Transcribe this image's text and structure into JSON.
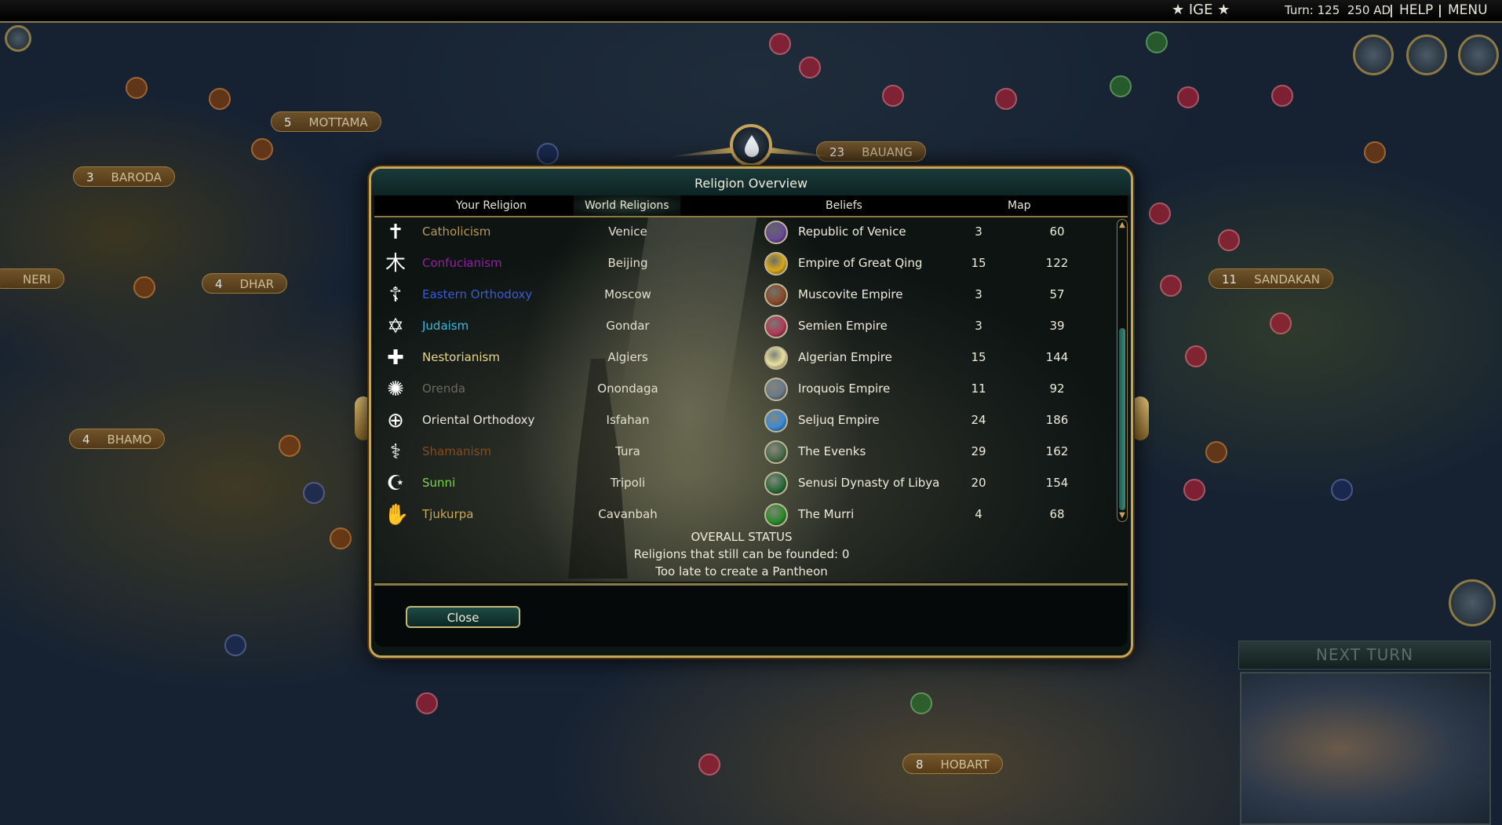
{
  "topbar": {
    "ige_label": "★ IGE ★",
    "turn_label": "Turn: 125",
    "date_label": "250 AD",
    "help_label": "HELP",
    "menu_label": "MENU"
  },
  "map": {
    "cities": [
      {
        "pop": "5",
        "name": "MOTTAMA"
      },
      {
        "pop": "3",
        "name": "BARODA"
      },
      {
        "pop": "4",
        "name": "DHAR"
      },
      {
        "pop": "4",
        "name": "BHAMO"
      },
      {
        "pop": "23",
        "name": "BAUANG"
      },
      {
        "pop": "11",
        "name": "SANDAKAN"
      },
      {
        "pop": "8",
        "name": "HOBART"
      },
      {
        "pop": "",
        "name": "NERI"
      }
    ],
    "next_turn_label": "NEXT TURN"
  },
  "dialog": {
    "title": "Religion Overview",
    "tabs": [
      "Your Religion",
      "World Religions",
      "Beliefs",
      "Map"
    ],
    "active_tab": "World Religions",
    "religions": [
      {
        "icon": "✝",
        "name": "Catholicism",
        "color": "#b8985a",
        "city": "Venice",
        "civ": "Republic of Venice",
        "civ_color": "#6a4a9a",
        "followers": "3",
        "cities": "60"
      },
      {
        "icon": "木",
        "name": "Confucianism",
        "color": "#9a1aa8",
        "city": "Beijing",
        "civ": "Empire of Great Qing",
        "civ_color": "#d8a818",
        "followers": "15",
        "cities": "122"
      },
      {
        "icon": "☦",
        "name": "Eastern Orthodoxy",
        "color": "#3a5ad8",
        "city": "Moscow",
        "civ": "Muscovite Empire",
        "civ_color": "#8a4a2a",
        "followers": "3",
        "cities": "57"
      },
      {
        "icon": "✡",
        "name": "Judaism",
        "color": "#3ab8e0",
        "city": "Gondar",
        "civ": "Semien Empire",
        "civ_color": "#b03a5a",
        "followers": "3",
        "cities": "39"
      },
      {
        "icon": "✚",
        "name": "Nestorianism",
        "color": "#e8d88a",
        "city": "Algiers",
        "civ": "Algerian Empire",
        "civ_color": "#e8e0a0",
        "followers": "15",
        "cities": "144"
      },
      {
        "icon": "✺",
        "name": "Orenda",
        "color": "#6a6a5a",
        "city": "Onondaga",
        "civ": "Iroquois Empire",
        "civ_color": "#6a7a8a",
        "followers": "11",
        "cities": "92"
      },
      {
        "icon": "⊕",
        "name": "Oriental Orthodoxy",
        "color": "#e8e4d8",
        "city": "Isfahan",
        "civ": "Seljuq Empire",
        "civ_color": "#3a8ad8",
        "followers": "24",
        "cities": "186"
      },
      {
        "icon": "⚕",
        "name": "Shamanism",
        "color": "#8a4a1a",
        "city": "Tura",
        "civ": "The Evenks",
        "civ_color": "#4a6a4a",
        "followers": "29",
        "cities": "162"
      },
      {
        "icon": "☪",
        "name": "Sunni",
        "color": "#7ad848",
        "city": "Tripoli",
        "civ": "Senusi Dynasty of Libya",
        "civ_color": "#2a6a3a",
        "followers": "20",
        "cities": "154"
      },
      {
        "icon": "✋",
        "name": "Tjukurpa",
        "color": "#c8a85a",
        "city": "Cavanbah",
        "civ": "The Murri",
        "civ_color": "#2a8a2a",
        "followers": "4",
        "cities": "68"
      }
    ],
    "status": {
      "heading": "OVERALL STATUS",
      "can_be_founded": "Religions that still can be founded: 0",
      "pantheon": "Too late to create a Pantheon"
    },
    "close_label": "Close"
  }
}
